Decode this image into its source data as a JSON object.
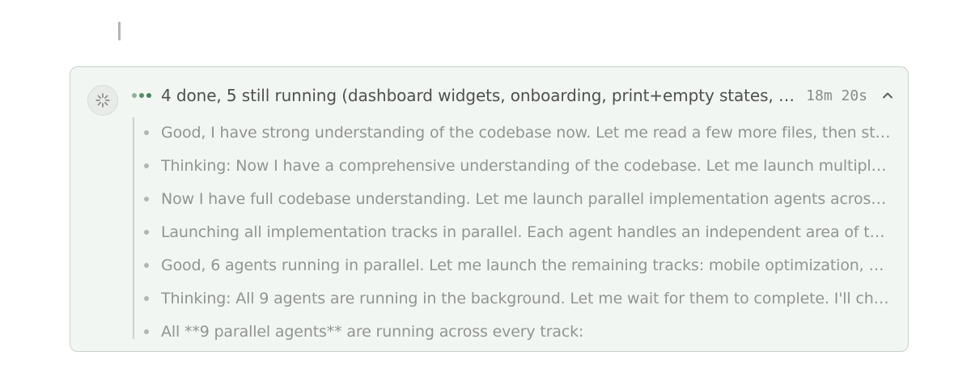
{
  "task": {
    "summary": "4 done, 5 still running (dashboard widgets, onboarding, print+empty states, mobile optimization, accessibility)",
    "elapsed": "18m 20s",
    "status_icon": "spinner-icon",
    "progress_dots": "ellipsis-dots-icon",
    "collapse_icon": "chevron-up-icon",
    "colors": {
      "panel_bg": "#f2f6f3",
      "panel_border": "#c9d2cb",
      "accent_green": "#46845a"
    }
  },
  "steps": [
    {
      "text": "Good, I have strong understanding of the codebase now. Let me read a few more files, then start the implementation."
    },
    {
      "text": "Thinking: Now I have a comprehensive understanding of the codebase. Let me launch multiple agents in parallel."
    },
    {
      "text": "Now I have full codebase understanding. Let me launch parallel implementation agents across every track."
    },
    {
      "text": "Launching all implementation tracks in parallel. Each agent handles an independent area of the codebase."
    },
    {
      "text": "Good, 6 agents running in parallel. Let me launch the remaining tracks: mobile optimization, accessibility, and print."
    },
    {
      "text": "Thinking: All 9 agents are running in the background. Let me wait for them to complete. I'll check status periodically."
    },
    {
      "text": "All **9 parallel agents** are running across every track:"
    }
  ]
}
